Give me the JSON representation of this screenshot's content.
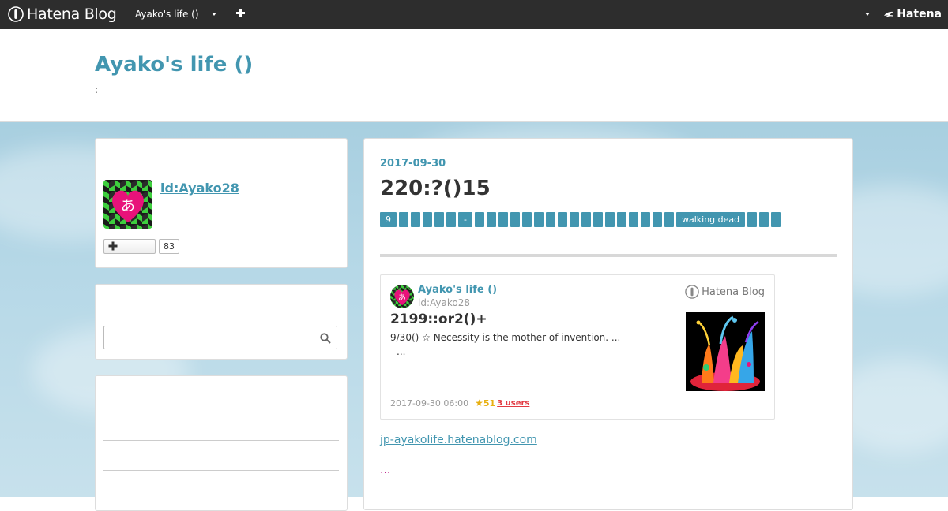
{
  "topbar": {
    "brand": "Hatena Blog",
    "blog_switch": "Ayako's life ()",
    "hatena_logo": "Hatena"
  },
  "header": {
    "title": "Ayako's life ()",
    "description": ":"
  },
  "sidebar": {
    "profile": {
      "user_id": "id:Ayako28",
      "avatar_char": "あ",
      "follower_count": "83"
    },
    "search": {
      "placeholder": ""
    }
  },
  "entry": {
    "date": "2017-09-30",
    "title": "220:?()15",
    "categories": [
      "9",
      "",
      "",
      "",
      "",
      "",
      "-",
      "",
      "",
      "",
      "",
      "",
      "",
      "",
      "",
      "",
      "",
      "",
      "",
      "",
      "",
      "",
      "",
      "",
      "walking dead",
      "",
      "",
      ""
    ],
    "embed": {
      "blog_name": "Ayako's life ()",
      "user_id": "id:Ayako28",
      "brand": "Hatena Blog",
      "title": "2199::or2()+",
      "desc_line1": "9/30() ☆ Necessity is the mother of invention. ...",
      "desc_line2": "...",
      "timestamp": "2017-09-30 06:00",
      "star_glyph": "★",
      "star_count": "51",
      "users": "3 users"
    },
    "link_text": "jp-ayakolife.hatenablog.com",
    "more": "..."
  },
  "colors": {
    "accent": "#4296b0",
    "topbar": "#2d2d2d",
    "magenta": "#c0278f"
  }
}
